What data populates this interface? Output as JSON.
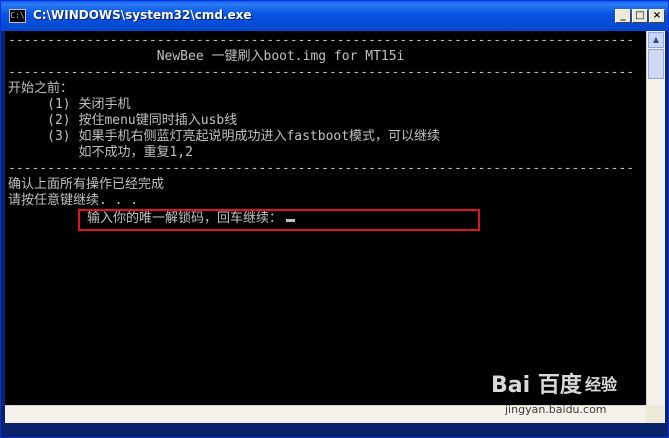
{
  "window": {
    "title": "C:\\WINDOWS\\system32\\cmd.exe",
    "icon_label": "C:\\",
    "controls": [
      "_",
      "□",
      "×"
    ]
  },
  "console": {
    "lines": [
      "--------------------------------------------------------------------------------",
      "                   NewBee 一键刷入boot.img for MT15i",
      "--------------------------------------------------------------------------------",
      "开始之前：",
      "     (1) 关闭手机",
      "     (2) 按住menu键同时插入usb线",
      "     (3) 如果手机右侧蓝灯亮起说明成功进入fastboot模式，可以继续",
      "         如不成功，重复1,2",
      "--------------------------------------------------------------------------------",
      "确认上面所有操作已经完成",
      "请按任意键继续. . ."
    ],
    "prompt": "输入你的唯一解锁码，回车继续："
  },
  "watermark": {
    "logo": "Bai 百度",
    "label": "经验",
    "url": "jingyan.baidu.com"
  },
  "colors": {
    "console_bg": "#000000",
    "console_text": "#c0c0c0",
    "highlight": "#e0141c",
    "titlebar": "#0553e0"
  }
}
